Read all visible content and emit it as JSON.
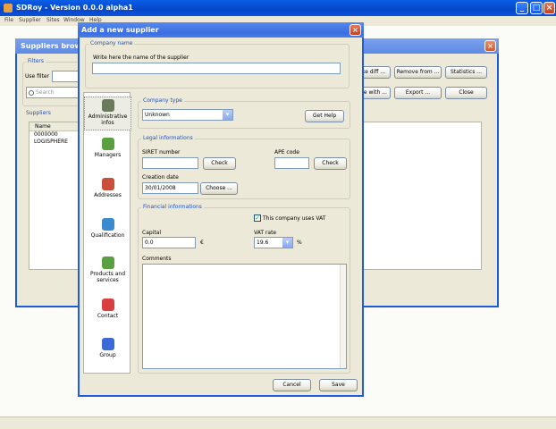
{
  "main_window": {
    "title": "SDRoy - Version 0.0.0 alpha1",
    "menu": [
      "File",
      "Supplier",
      "Sites",
      "Window",
      "Help"
    ],
    "controls": {
      "minimize": "_",
      "maximize": "□",
      "close": "×"
    }
  },
  "suppliers_window": {
    "title": "Suppliers browser",
    "filters_label": "Filters",
    "use_filter_label": "Use filter",
    "search_placeholder": "Search",
    "suppliers_label": "Suppliers",
    "column_name": "Name",
    "rows": [
      "0000000",
      "LOGISPHERE"
    ],
    "buttons": {
      "make_diff": "ke diff ...",
      "remove_from": "Remove from ...",
      "statistics": "Statistics ...",
      "merge_with": "ge with ...",
      "export": "Export ...",
      "close": "Close"
    }
  },
  "dialog": {
    "title": "Add a new supplier",
    "company_name_label": "Company name",
    "company_name_placeholder": "Write here the name of the supplier",
    "nav": [
      {
        "label": "Administrative infos",
        "icon": "info-icon",
        "color": "#6a7a5a"
      },
      {
        "label": "Managers",
        "icon": "managers-icon",
        "color": "#5aa040"
      },
      {
        "label": "Addresses",
        "icon": "addresses-icon",
        "color": "#c8503a"
      },
      {
        "label": "Qualification",
        "icon": "qualification-icon",
        "color": "#3a8ad0"
      },
      {
        "label": "Products and services",
        "icon": "products-icon",
        "color": "#5aa040"
      },
      {
        "label": "Contact",
        "icon": "contact-icon",
        "color": "#d84040"
      },
      {
        "label": "Group",
        "icon": "group-icon",
        "color": "#3a6ad8"
      }
    ],
    "company_type": {
      "label": "Company type",
      "value": "Unknown",
      "help_button": "Get Help"
    },
    "legal": {
      "label": "Legal informations",
      "siret_label": "SIRET number",
      "siret_value": "",
      "check_label": "Check",
      "ape_label": "APE code",
      "ape_value": "",
      "creation_date_label": "Creation date",
      "creation_date_value": "30/01/2008",
      "choose_button": "Choose ..."
    },
    "financial": {
      "label": "Financial informations",
      "vat_checkbox_label": "This company uses VAT",
      "vat_checked": true,
      "capital_label": "Capital",
      "capital_value": "0.0",
      "capital_unit": "€",
      "vat_rate_label": "VAT rate",
      "vat_rate_value": "19.6",
      "vat_unit": "%",
      "comments_label": "Comments"
    },
    "buttons": {
      "cancel": "Cancel",
      "save": "Save"
    }
  }
}
